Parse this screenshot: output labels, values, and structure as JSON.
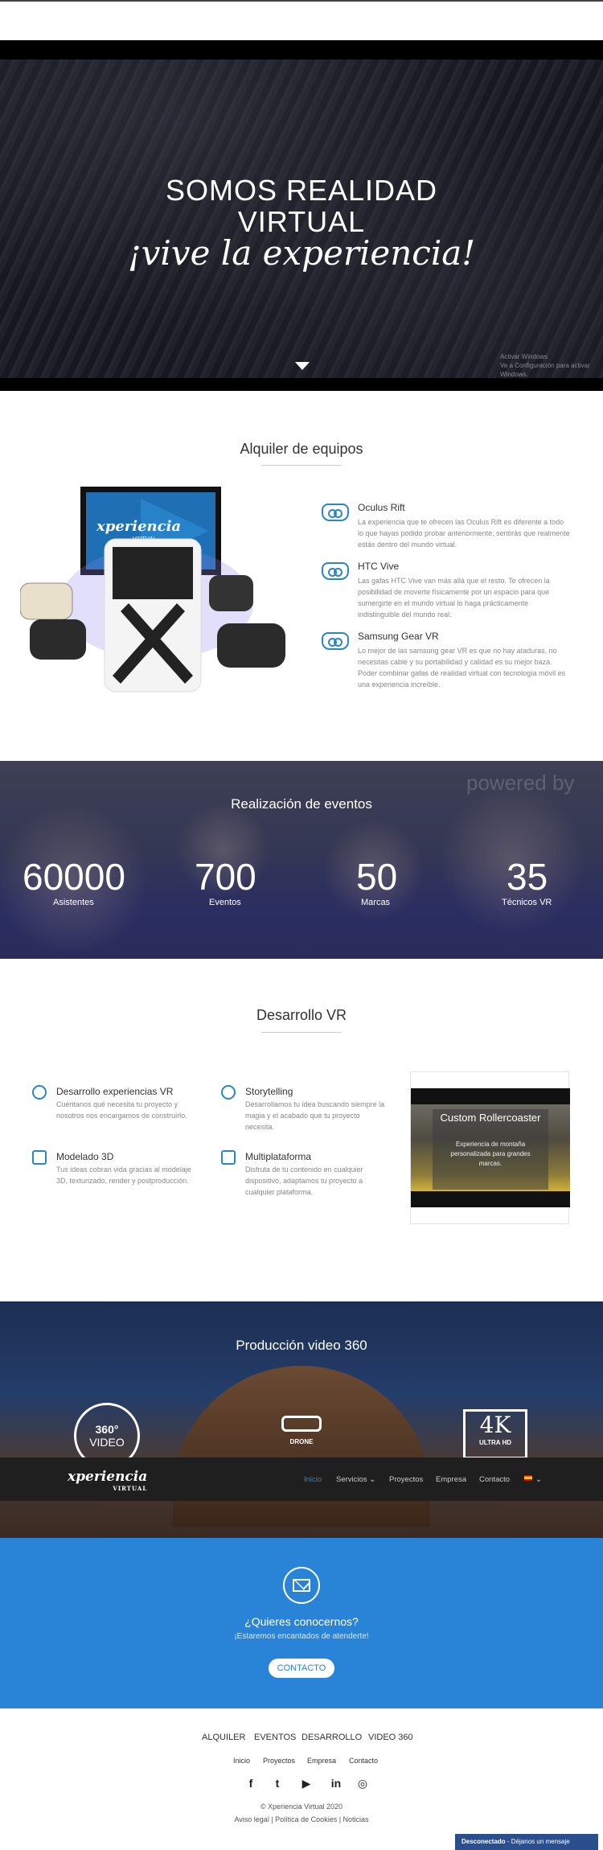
{
  "hero": {
    "line1": "SOMOS REALIDAD",
    "line2": "VIRTUAL",
    "line3": "¡vive la experiencia!",
    "watermark1": "Activar Windows",
    "watermark2": "Ve a Configuración para activar Windows."
  },
  "rental": {
    "title": "Alquiler de equipos",
    "items": [
      {
        "name": "Oculus Rift",
        "desc": "La experiencia que te ofrecen las Oculus Rift es diferente a todo lo que hayas podido probar anteriormente, sentirás que realmente estás dentro del mundo virtual.",
        "icon": "vr-headset-icon"
      },
      {
        "name": "HTC Vive",
        "desc": "Las gafas HTC Vive van más allá que el resto. Te ofrecen la posibilidad de moverte físicamente por un espacio para que sumergirte en el mundo virtual lo haga prácticamente indistinguible del mundo real.",
        "icon": "vr-headset-icon"
      },
      {
        "name": "Samsung Gear VR",
        "desc": "Lo mejor de las samsung gear VR es que no hay ataduras, no necesitas cable y su portabilidad y calidad es su mejor baza. Poder combinar gafas de realidad virtual con tecnología móvil es una experiencia increíble.",
        "icon": "vr-headset-icon"
      }
    ],
    "image_logo": "xperiencia",
    "image_logo_sub": "VIRTUAL"
  },
  "events": {
    "title": "Realización de eventos",
    "watermark": "powered by",
    "stats": [
      {
        "num": "60000",
        "label": "Asistentes"
      },
      {
        "num": "700",
        "label": "Eventos"
      },
      {
        "num": "50",
        "label": "Marcas"
      },
      {
        "num": "35",
        "label": "Técnicos VR"
      }
    ]
  },
  "dev": {
    "title": "Desarrollo VR",
    "items": [
      {
        "name": "Desarrollo experiencias VR",
        "desc": "Cuéntanos qué necesita tu proyecto y nosotros nos encargamos de construirlo.",
        "icon": "gear-icon"
      },
      {
        "name": "Storytelling",
        "desc": "Desarrollamos tu idea buscando siempre la magia y el acabado que tu proyecto necesita.",
        "icon": "brain-icon"
      },
      {
        "name": "Modelado 3D",
        "desc": "Tus ideas cobran vida gracias al modelaje 3D, texturizado, render y postproducción.",
        "icon": "3d-model-icon"
      },
      {
        "name": "Multiplataforma",
        "desc": "Disfruta de tu contenido en cualquier dispositivo, adaptamos tu proyecto a cualquier plataforma.",
        "icon": "devices-icon"
      }
    ],
    "slide": {
      "title": "Custom Rollercoaster",
      "desc": "Experiencia de montaña personalizada para grandes marcas."
    }
  },
  "video": {
    "title": "Producción video 360",
    "badge360_a": "360°",
    "badge360_b": "VIDEO",
    "drone": "DRONE",
    "k4_a": "4K",
    "k4_b": "ULTRA HD"
  },
  "nav": {
    "logo": "xperiencia",
    "logo_sub": "VIRTUAL",
    "items": [
      "Inicio",
      "Servicios",
      "Proyectos",
      "Empresa",
      "Contacto"
    ],
    "servicios_arrow": "⌄",
    "lang_arrow": "⌄"
  },
  "contact": {
    "title": "¿Quieres conocernos?",
    "sub": "¡Estaremos encantados de atenderte!",
    "button": "CONTACTO"
  },
  "footer": {
    "main": [
      "ALQUILER",
      "EVENTOS",
      "DESARROLLO",
      "VIDEO 360"
    ],
    "small": [
      "Inicio",
      "Proyectos",
      "Empresa",
      "Contacto"
    ],
    "social": [
      "facebook-icon",
      "twitter-icon",
      "youtube-icon",
      "linkedin-icon",
      "instagram-icon"
    ],
    "social_glyphs": [
      "f",
      "t",
      "▶",
      "in",
      "◎"
    ],
    "copyright": "© Xperiencia Virtual 2020",
    "legal": "Aviso legal | Política de Cookies | Noticias"
  },
  "chat": {
    "status": "Desconectado",
    "text": " - Déjanos un mensaje"
  },
  "colors": {
    "accent": "#2a85c9",
    "contact_bg": "#2983d6",
    "nav_bg": "#1f1f1f"
  }
}
